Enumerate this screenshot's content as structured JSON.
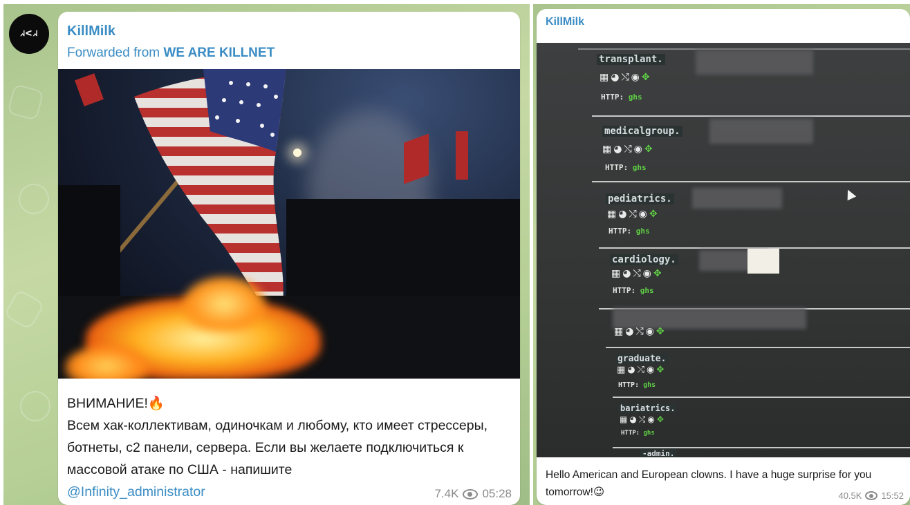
{
  "left_post": {
    "avatar_text": "ᖽᐸᖽ",
    "sender": "KillMilk",
    "forward_prefix": "Forwarded from",
    "forward_source": "WE ARE KILLNET",
    "caption_line1": "ВНИМАНИЕ!🔥",
    "caption_body": "Всем хак-коллективам, одиночкам и любому, кто имеет стрессеры, ботнеты, с2 панели, сервера. Если вы желаете подключиться к массовой атаке по США - напишите",
    "caption_link": "@Infinity_administrator",
    "views": "7.4K",
    "time": "05:28"
  },
  "right_post": {
    "sender": "KillMilk",
    "caption": "Hello American and European clowns. I have a huge surprise for you tomorrow!😉",
    "views": "40.5K",
    "time": "15:52",
    "screen_entries": [
      {
        "name": "transplant.",
        "http_label": "HTTP:",
        "http_value": "ghs"
      },
      {
        "name": "medicalgroup.",
        "http_label": "HTTP:",
        "http_value": "ghs"
      },
      {
        "name": "pediatrics.",
        "http_label": "HTTP:",
        "http_value": "ghs"
      },
      {
        "name": "cardiology.",
        "http_label": "HTTP:",
        "http_value": "ghs"
      },
      {
        "name": "",
        "http_label": "",
        "http_value": ""
      },
      {
        "name": "graduate.",
        "http_label": "HTTP:",
        "http_value": "ghs"
      },
      {
        "name": "bariatrics.",
        "http_label": "HTTP:",
        "http_value": "ghs"
      },
      {
        "name": "-admin.",
        "http_label": "",
        "http_value": ""
      }
    ],
    "icon_row": "▦◕⤭◉",
    "icon_row_accent": "✥"
  },
  "colors": {
    "link": "#3a8cc4",
    "chat_bg": "#b5cf96",
    "bubble": "#ffffff",
    "meta": "#8b8b8b",
    "terminal_green": "#5fcf44"
  }
}
